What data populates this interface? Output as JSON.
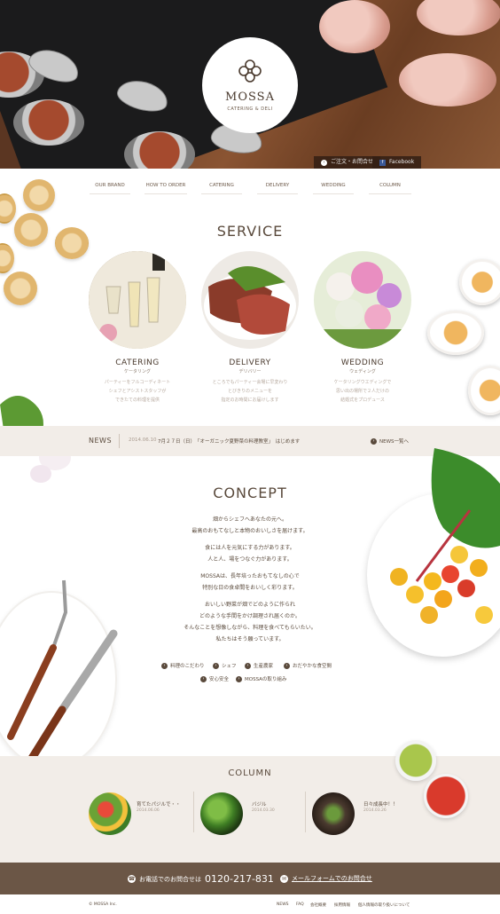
{
  "brand": {
    "name": "MOSSA",
    "tagline": "CATERING & DELI"
  },
  "hero": {
    "order_btn": "ご注文・お問合せ",
    "facebook_btn": "Facebook"
  },
  "nav": [
    {
      "label": "OUR BRAND"
    },
    {
      "label": "HOW TO ORDER"
    },
    {
      "label": "CATERING"
    },
    {
      "label": "DELIVERY"
    },
    {
      "label": "WEDDING"
    },
    {
      "label": "COLUMN"
    }
  ],
  "service": {
    "title": "SERVICE",
    "items": [
      {
        "title": "CATERING",
        "kana": "ケータリング",
        "desc": [
          "パーティーをフルコーディネート",
          "シェフとアシストスタッフが",
          "できたての料理を提供"
        ]
      },
      {
        "title": "DELIVERY",
        "kana": "デリバリー",
        "desc": [
          "ところでもパーティー会場に早変わり",
          "とびきりのメニューを",
          "指定のお時間にお届けします"
        ]
      },
      {
        "title": "WEDDING",
        "kana": "ウェディング",
        "desc": [
          "ケータリングウエディングで",
          "思い出の場所で２人だけの",
          "結婚式をプロデュース"
        ]
      }
    ]
  },
  "news": {
    "label": "NEWS",
    "date": "2014.06.10",
    "text": "7月２７日（日）　「オーガニック夏野菜の料理教室」　はじめます",
    "more": "NEWS一覧へ"
  },
  "concept": {
    "title": "CONCEPT",
    "paragraphs": [
      [
        "畑からシェフへあなたの元へ。",
        "最高のおもてなしと本物のおいしさを届けます。"
      ],
      [
        "食には人を元気にする力があります。",
        "人と人、場をつなぐ力があります。"
      ],
      [
        "MOSSAは、長年培ったおもてなしの心で",
        "特別な日の食卓間をおいしく彩ります。"
      ],
      [
        "おいしい野菜が畑でどのように作られ",
        "どのような手間をかけ調理され届くのか。",
        "そんなことを想像しながら、料理を食べてもらいたい。",
        "私たちはそう願っています。"
      ]
    ],
    "tags": [
      "料理のこだわり",
      "シェフ",
      "生産農家",
      "おだやかな食空間",
      "安心安全",
      "MOSSAの取り組み"
    ]
  },
  "column": {
    "title": "COLUMN",
    "items": [
      {
        "title": "育てたパジルで・・",
        "date": "2014.06.06"
      },
      {
        "title": "バジル",
        "date": "2014.03.30"
      },
      {
        "title": "日々成長中！！",
        "date": "2014.03.26"
      }
    ]
  },
  "contact": {
    "phone_label": "お電話でのお問合せは",
    "phone": "0120-217-831",
    "form_label": "メールフォームでのお問合せ"
  },
  "footer": {
    "copyright": "© MOSSA Inc.",
    "links": [
      "NEWS",
      "FAQ",
      "会社概要",
      "採用情報",
      "個人情報の取り扱いについて"
    ]
  }
}
